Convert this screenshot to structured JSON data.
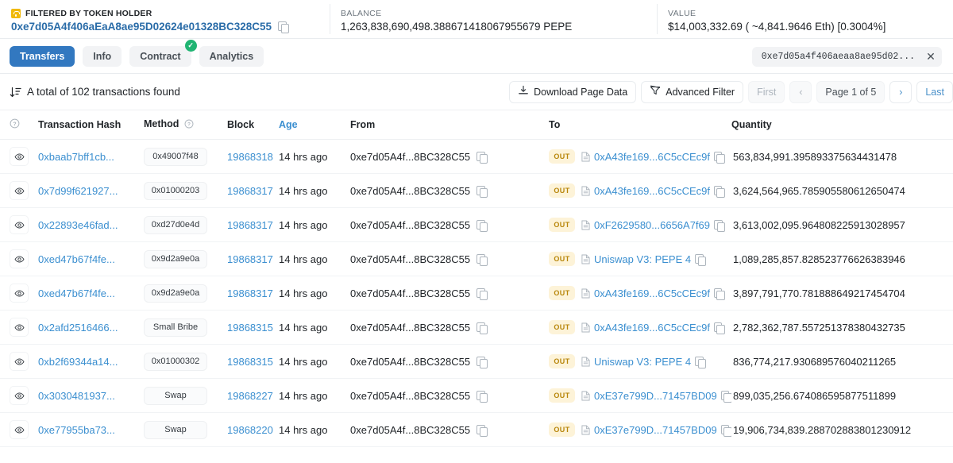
{
  "summary": {
    "filter": {
      "label": "FILTERED BY TOKEN HOLDER",
      "address": "0xe7d05A4f406aEaA8ae95D02624e01328BC328C55",
      "icon": "lock-icon",
      "copy_icon": "copy-icon"
    },
    "balance": {
      "label": "BALANCE",
      "value": "1,263,838,690,498.388671418067955679 PEPE"
    },
    "value": {
      "label": "VALUE",
      "value": "$14,003,332.69 ( ~4,841.9646 Eth) [0.3004%]"
    }
  },
  "tabs": [
    {
      "label": "Transfers",
      "active": true,
      "verified": false
    },
    {
      "label": "Info",
      "active": false,
      "verified": false
    },
    {
      "label": "Contract",
      "active": false,
      "verified": true,
      "check": "✓"
    },
    {
      "label": "Analytics",
      "active": false,
      "verified": false
    }
  ],
  "filter_chip": {
    "text": "0xe7d05a4f406aeaa8ae95d02...",
    "close": "✕"
  },
  "toolbar": {
    "total_text": "A total of 102 transactions found",
    "sort_icon": "sort-descending-icon",
    "download_label": "Download Page Data",
    "download_icon": "download-icon",
    "advanced_filter_label": "Advanced Filter",
    "filter_icon": "funnel-icon",
    "first_label": "First",
    "prev_icon": "‹",
    "page_label": "Page 1 of 5",
    "next_icon": "›",
    "last_label": "Last"
  },
  "table": {
    "headers": {
      "eye": "",
      "eye_icon": "question-circle-icon",
      "hash": "Transaction Hash",
      "method": "Method",
      "method_icon": "question-circle-icon",
      "block": "Block",
      "age": "Age",
      "from": "From",
      "to": "To",
      "quantity": "Quantity"
    },
    "rows": [
      {
        "hash": "0xbaab7bff1cb...",
        "method": "0x49007f48",
        "block": "19868318",
        "age": "14 hrs ago",
        "from": "0xe7d05A4f...8BC328C55",
        "direction": "OUT",
        "to": "0xA43fe169...6C5cCEc9f",
        "quantity": "563,834,991.395893375634431478"
      },
      {
        "hash": "0x7d99f621927...",
        "method": "0x01000203",
        "block": "19868317",
        "age": "14 hrs ago",
        "from": "0xe7d05A4f...8BC328C55",
        "direction": "OUT",
        "to": "0xA43fe169...6C5cCEc9f",
        "quantity": "3,624,564,965.785905580612650474"
      },
      {
        "hash": "0x22893e46fad...",
        "method": "0xd27d0e4d",
        "block": "19868317",
        "age": "14 hrs ago",
        "from": "0xe7d05A4f...8BC328C55",
        "direction": "OUT",
        "to": "0xF2629580...6656A7f69",
        "quantity": "3,613,002,095.964808225913028957"
      },
      {
        "hash": "0xed47b67f4fe...",
        "method": "0x9d2a9e0a",
        "block": "19868317",
        "age": "14 hrs ago",
        "from": "0xe7d05A4f...8BC328C55",
        "direction": "OUT",
        "to": "Uniswap V3: PEPE 4",
        "quantity": "1,089,285,857.828523776626383946"
      },
      {
        "hash": "0xed47b67f4fe...",
        "method": "0x9d2a9e0a",
        "block": "19868317",
        "age": "14 hrs ago",
        "from": "0xe7d05A4f...8BC328C55",
        "direction": "OUT",
        "to": "0xA43fe169...6C5cCEc9f",
        "quantity": "3,897,791,770.781888649217454704"
      },
      {
        "hash": "0x2afd2516466...",
        "method": "Small Bribe",
        "block": "19868315",
        "age": "14 hrs ago",
        "from": "0xe7d05A4f...8BC328C55",
        "direction": "OUT",
        "to": "0xA43fe169...6C5cCEc9f",
        "quantity": "2,782,362,787.557251378380432735"
      },
      {
        "hash": "0xb2f69344a14...",
        "method": "0x01000302",
        "block": "19868315",
        "age": "14 hrs ago",
        "from": "0xe7d05A4f...8BC328C55",
        "direction": "OUT",
        "to": "Uniswap V3: PEPE 4",
        "quantity": "836,774,217.930689576040211265"
      },
      {
        "hash": "0x3030481937...",
        "method": "Swap",
        "block": "19868227",
        "age": "14 hrs ago",
        "from": "0xe7d05A4f...8BC328C55",
        "direction": "OUT",
        "to": "0xE37e799D...71457BD09",
        "quantity": "899,035,256.674086595877511899"
      },
      {
        "hash": "0xe77955ba73...",
        "method": "Swap",
        "block": "19868220",
        "age": "14 hrs ago",
        "from": "0xe7d05A4f...8BC328C55",
        "direction": "OUT",
        "to": "0xE37e799D...71457BD09",
        "quantity": "19,906,734,839.288702883801230912"
      }
    ]
  },
  "colors": {
    "accent": "#3b8fd0",
    "tab_active": "#3278c0",
    "verified": "#21b573",
    "out_badge_bg": "#fdf3d8",
    "out_badge_text": "#b8860b",
    "lock": "#f0b90b"
  }
}
